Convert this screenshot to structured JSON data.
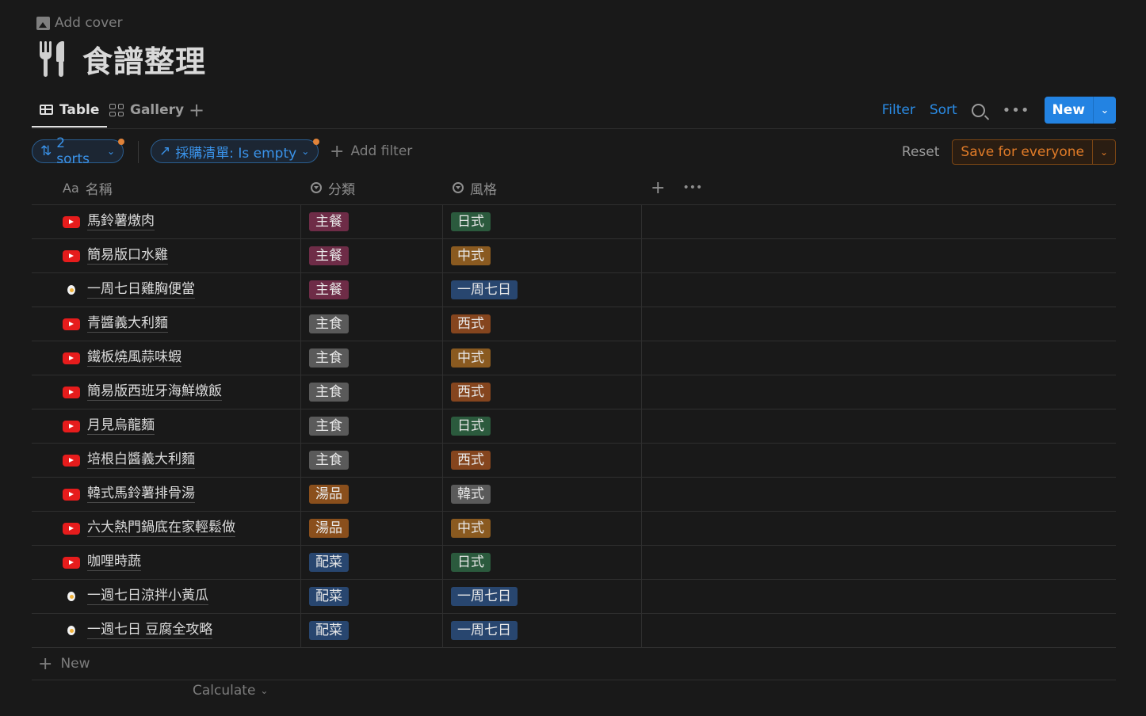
{
  "page": {
    "add_cover": "Add cover",
    "title": "食譜整理",
    "icon": "fork-knife-icon"
  },
  "views": {
    "tabs": [
      {
        "label": "Table",
        "icon": "table-icon",
        "active": true
      },
      {
        "label": "Gallery",
        "icon": "gallery-icon",
        "active": false
      }
    ],
    "add": "+",
    "filter": "Filter",
    "sort": "Sort",
    "more": "•••",
    "new": "New"
  },
  "filters": {
    "sorts": "2 sorts",
    "filter_chip": "採購清單: Is empty",
    "add_filter": "Add filter",
    "reset": "Reset",
    "save": "Save for everyone"
  },
  "table": {
    "columns": [
      {
        "label": "名稱",
        "type_icon": "Aa"
      },
      {
        "label": "分類",
        "icon": "select-icon"
      },
      {
        "label": "風格",
        "icon": "select-icon"
      }
    ],
    "header_add": "+",
    "header_more": "•••",
    "rows": [
      {
        "name": "馬鈴薯燉肉",
        "icon": "youtube",
        "category": "主餐",
        "style": "日式"
      },
      {
        "name": "簡易版口水雞",
        "icon": "youtube",
        "category": "主餐",
        "style": "中式"
      },
      {
        "name": "一周七日雞胸便當",
        "icon": "egg",
        "category": "主餐",
        "style": "一周七日"
      },
      {
        "name": "青醬義大利麵",
        "icon": "youtube",
        "category": "主食",
        "style": "西式"
      },
      {
        "name": "鐵板燒風蒜味蝦",
        "icon": "youtube",
        "category": "主食",
        "style": "中式"
      },
      {
        "name": "簡易版西班牙海鮮燉飯",
        "icon": "youtube",
        "category": "主食",
        "style": "西式"
      },
      {
        "name": "月見烏龍麵",
        "icon": "youtube",
        "category": "主食",
        "style": "日式"
      },
      {
        "name": "培根白醬義大利麵",
        "icon": "youtube",
        "category": "主食",
        "style": "西式"
      },
      {
        "name": "韓式馬鈴薯排骨湯",
        "icon": "youtube",
        "category": "湯品",
        "style": "韓式"
      },
      {
        "name": "六大熱門鍋底在家輕鬆做",
        "icon": "youtube",
        "category": "湯品",
        "style": "中式"
      },
      {
        "name": "咖哩時蔬",
        "icon": "youtube",
        "category": "配菜",
        "style": "日式"
      },
      {
        "name": "一週七日涼拌小黃瓜",
        "icon": "egg",
        "category": "配菜",
        "style": "一周七日"
      },
      {
        "name": "一週七日 豆腐全攻略",
        "icon": "egg",
        "category": "配菜",
        "style": "一周七日"
      }
    ],
    "new_row": "New",
    "calculate": "Calculate"
  },
  "colors": {
    "accent": "#2383e2",
    "save_orange": "#e07b28",
    "tag_main": "#6e2c47",
    "tag_staple": "#5a5a5a",
    "tag_soup": "#8a4f1c",
    "tag_side": "#28466f",
    "tag_jp": "#2b5a3d",
    "tag_cn": "#8a5a20",
    "tag_west": "#85451e",
    "tag_kr": "#5a5a5a",
    "tag_week": "#28466f"
  }
}
